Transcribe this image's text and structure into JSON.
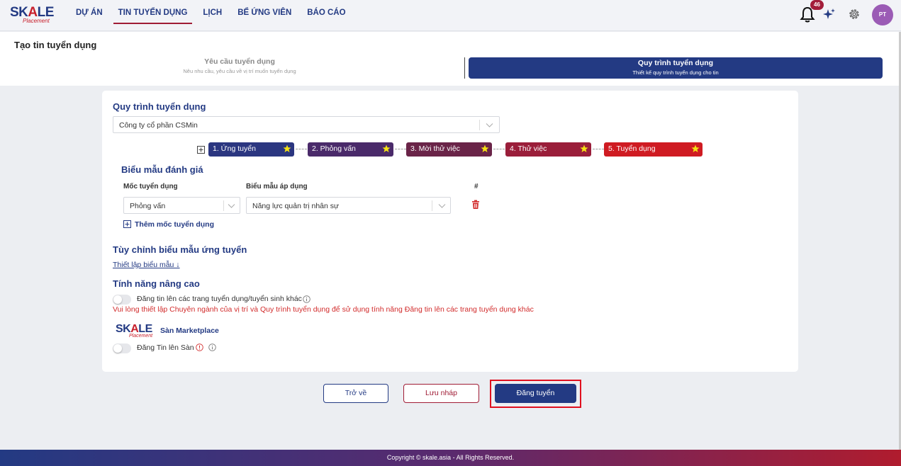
{
  "brand": {
    "logo_main_1": "SK",
    "logo_main_a": "A",
    "logo_main_2": "LE",
    "logo_sub": "Placement"
  },
  "nav": {
    "items": [
      {
        "label": "DỰ ÁN"
      },
      {
        "label": "TIN TUYỂN DỤNG"
      },
      {
        "label": "LỊCH"
      },
      {
        "label": "BỂ ỨNG VIÊN"
      },
      {
        "label": "BÁO CÁO"
      }
    ],
    "active_index": 1
  },
  "header_icons": {
    "notification_count": "46",
    "avatar_initials": "PT",
    "icons": [
      "bell-icon",
      "sparkle-icon",
      "gear-icon"
    ]
  },
  "page": {
    "title": "Tạo tin tuyển dụng"
  },
  "steps": [
    {
      "title": "Yêu cầu tuyển dụng",
      "subtitle": "Nêu nhu cầu, yêu cầu về vị trí muốn tuyển dụng",
      "active": false
    },
    {
      "title": "Quy trình tuyển dụng",
      "subtitle": "Thiết kế quy trình tuyển dụng cho tin",
      "active": true
    }
  ],
  "process": {
    "heading": "Quy trình tuyển dụng",
    "company_select": "Công ty cổ phần CSMin",
    "stages": [
      {
        "label": "1. Ứng tuyển",
        "color": "#2b3680"
      },
      {
        "label": "2. Phỏng vấn",
        "color": "#4a2a6a"
      },
      {
        "label": "3. Mời thử việc",
        "color": "#6a2448"
      },
      {
        "label": "4. Thử việc",
        "color": "#9a1e3a"
      },
      {
        "label": "5. Tuyển dụng",
        "color": "#cf1b22"
      }
    ]
  },
  "evaluation": {
    "heading": "Biểu mẫu đánh giá",
    "col_milestone": "Mốc tuyển dụng",
    "col_form": "Biểu mẫu áp dụng",
    "col_hash": "#",
    "row": {
      "milestone": "Phỏng vấn",
      "form": "Năng lực quản trị nhân sự"
    },
    "add_label": "Thêm mốc tuyển dụng"
  },
  "custom_form": {
    "heading": "Tùy chỉnh biểu mẫu ứng tuyển",
    "link": "Thiết lập biểu mẫu ↓"
  },
  "advanced": {
    "heading": "Tính năng nâng cao",
    "post_other_label": "Đăng tin lên các trang tuyển dụng/tuyển sinh khác",
    "warning": "Vui lòng thiết lập Chuyên ngành của vị trí và Quy trình tuyển dụng để sử dụng tính năng Đăng tin lên các trang tuyển dụng khác",
    "marketplace_label": "Sàn Marketplace",
    "post_market_label": "Đăng Tin lên Sàn"
  },
  "actions": {
    "back": "Trở về",
    "draft": "Lưu nháp",
    "post": "Đăng tuyển"
  },
  "footer": {
    "copyright": "Copyright © skale.asia - All Rights Reserved."
  },
  "colors": {
    "primary": "#233a83",
    "accent": "#a01c35",
    "danger": "#d22c2c"
  }
}
